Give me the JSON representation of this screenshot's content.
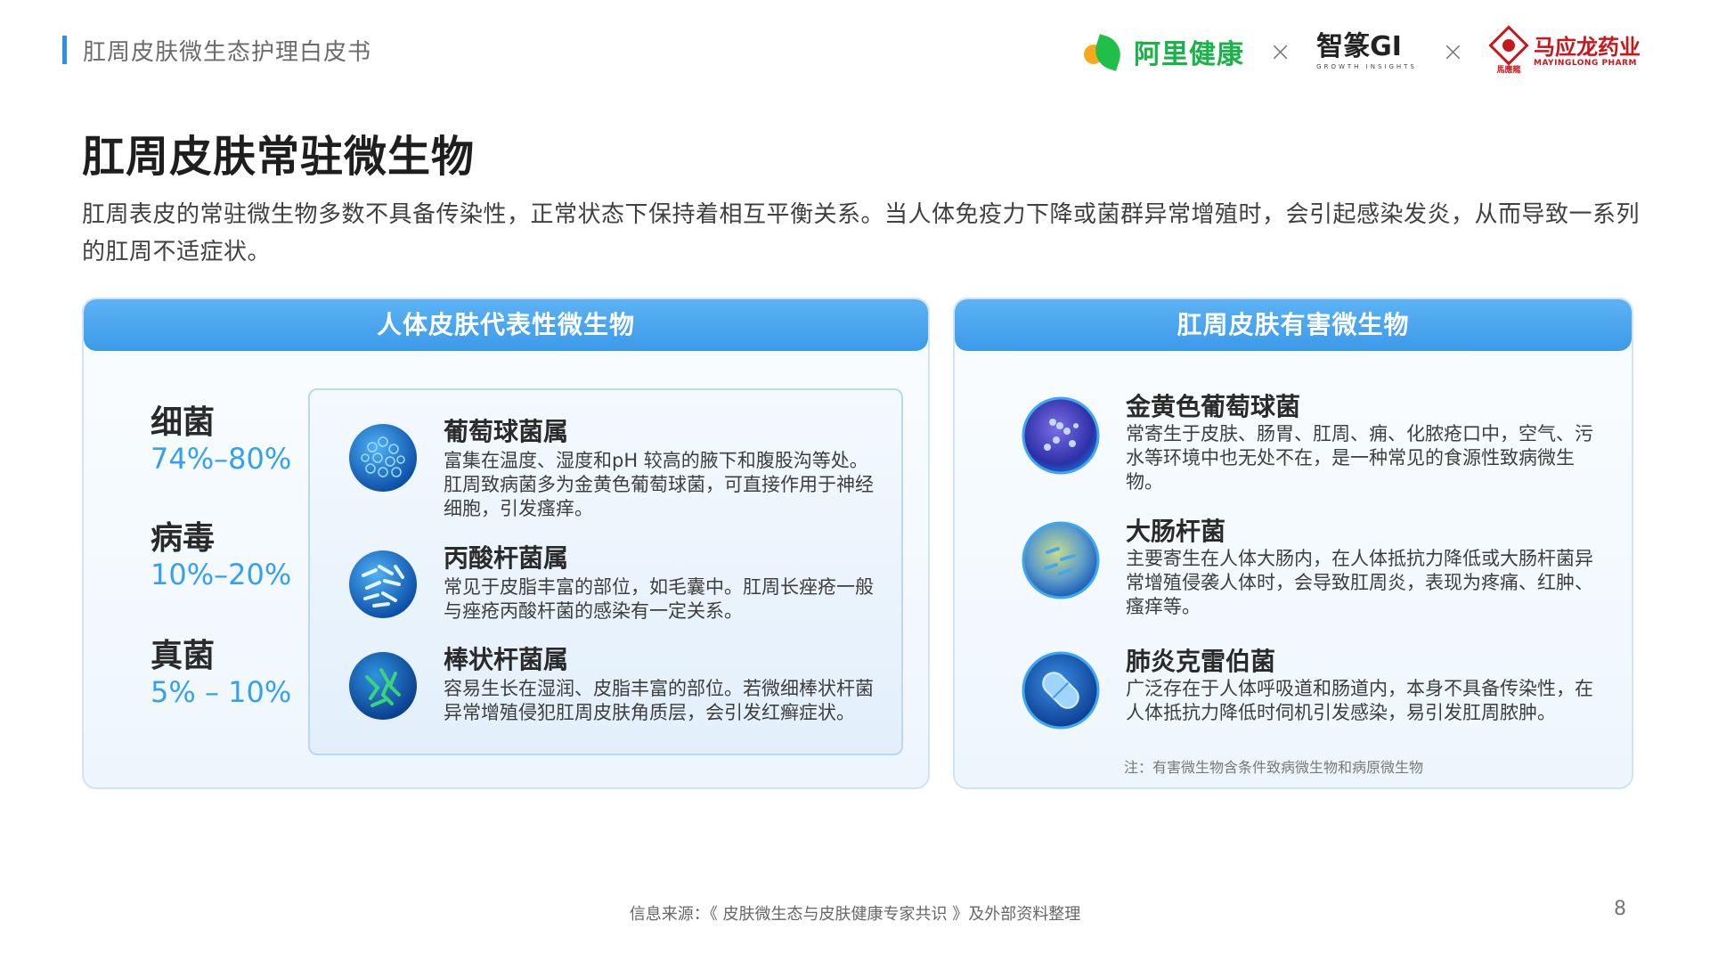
{
  "header": {
    "doc_title": "肛周皮肤微生态护理白皮书"
  },
  "logos": {
    "alihealth": "阿里健康",
    "times": "×",
    "zhizhuan": "智篆GI",
    "zhizhuan_sub": "GROWTH INSIGHTS",
    "mayinglong": "马应龙药业",
    "mayinglong_sub": "MAYINGLONG PHARM",
    "mayinglong_seal": "馬應龍"
  },
  "title": "肛周皮肤常驻微生物",
  "intro": "肛周表皮的常驻微生物多数不具备传染性，正常状态下保持着相互平衡关系。当人体免疫力下降或菌群异常增殖时，会引起感染发炎，从而导致一系列的肛周不适症状。",
  "left_panel": {
    "heading": "人体皮肤代表性微生物",
    "stats": [
      {
        "label": "细菌",
        "value": "74%–80%"
      },
      {
        "label": "病毒",
        "value": "10%–20%"
      },
      {
        "label": "真菌",
        "value": "5% – 10%"
      }
    ],
    "items": [
      {
        "name": "葡萄球菌属",
        "desc": "富集在温度、湿度和pH 较高的腋下和腹股沟等处。肛周致病菌多为金黄色葡萄球菌，可直接作用于神经细胞，引发瘙痒。",
        "icon": "staphylococcus-icon"
      },
      {
        "name": "丙酸杆菌属",
        "desc": "常见于皮脂丰富的部位，如毛囊中。肛周长痤疮一般与痤疮丙酸杆菌的感染有一定关系。",
        "icon": "propionibacterium-icon"
      },
      {
        "name": "棒状杆菌属",
        "desc": "容易生长在湿润、皮脂丰富的部位。若微细棒状杆菌异常增殖侵犯肛周皮肤角质层，会引发红癣症状。",
        "icon": "corynebacterium-icon"
      }
    ]
  },
  "right_panel": {
    "heading": "肛周皮肤有害微生物",
    "items": [
      {
        "name": "金黄色葡萄球菌",
        "desc": "常寄生于皮肤、肠胃、肛周、痈、化脓疮口中，空气、污水等环境中也无处不在，是一种常见的食源性致病微生物。",
        "icon": "staph-aureus-icon"
      },
      {
        "name": "大肠杆菌",
        "desc": "主要寄生在人体大肠内，在人体抵抗力降低或大肠杆菌异常增殖侵袭人体时，会导致肛周炎，表现为疼痛、红肿、瘙痒等。",
        "icon": "e-coli-icon"
      },
      {
        "name": "肺炎克雷伯菌",
        "desc": "广泛存在于人体呼吸道和肠道内，本身不具备传染性，在人体抵抗力降低时伺机引发感染，易引发肛周脓肿。",
        "icon": "klebsiella-icon"
      }
    ],
    "note": "注：有害微生物含条件致病微生物和病原微生物"
  },
  "footer": {
    "source": "信息来源：《 皮肤微生态与皮肤健康专家共识 》及外部资料整理",
    "page": "8"
  },
  "colors": {
    "accent": "#36a0ec",
    "panel_head": "#4aa5ee",
    "brand_green": "#19b34a",
    "brand_red": "#c8161d"
  }
}
